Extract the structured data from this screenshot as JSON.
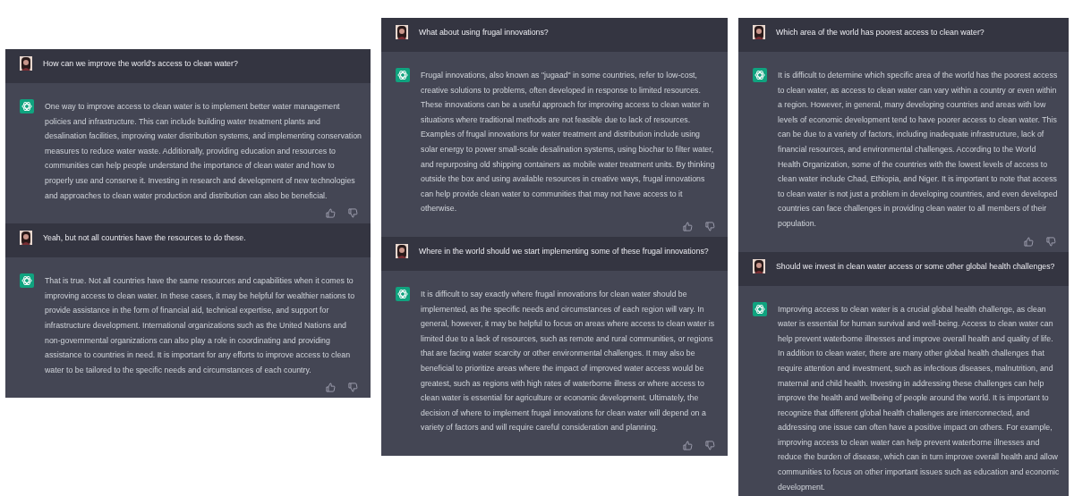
{
  "panels": [
    {
      "messages": [
        {
          "kind": "user",
          "text": "How can we improve the world's access to clean water?"
        },
        {
          "kind": "assistant",
          "feedback": true,
          "text": "One way to improve access to clean water is to implement better water management policies and infrastructure. This can include building water treatment plants and desalination facilities, improving water distribution systems, and implementing conservation measures to reduce water waste. Additionally, providing education and resources to communities can help people understand the importance of clean water and how to properly use and conserve it. Investing in research and development of new technologies and approaches to clean water production and distribution can also be beneficial."
        },
        {
          "kind": "user",
          "text": "Yeah, but not all countries have the resources to do these."
        },
        {
          "kind": "assistant",
          "feedback": true,
          "text": "That is true. Not all countries have the same resources and capabilities when it comes to improving access to clean water. In these cases, it may be helpful for wealthier nations to provide assistance in the form of financial aid, technical expertise, and support for infrastructure development. International organizations such as the United Nations and non-governmental organizations can also play a role in coordinating and providing assistance to countries in need. It is important for any efforts to improve access to clean water to be tailored to the specific needs and circumstances of each country."
        }
      ]
    },
    {
      "messages": [
        {
          "kind": "user",
          "text": "What about using frugal innovations?"
        },
        {
          "kind": "assistant",
          "feedback": true,
          "text": "Frugal innovations, also known as \"jugaad\" in some countries, refer to low-cost, creative solutions to problems, often developed in response to limited resources. These innovations can be a useful approach for improving access to clean water in situations where traditional methods are not feasible due to lack of resources. Examples of frugal innovations for water treatment and distribution include using solar energy to power small-scale desalination systems, using biochar to filter water, and repurposing old shipping containers as mobile water treatment units. By thinking outside the box and using available resources in creative ways, frugal innovations can help provide clean water to communities that may not have access to it otherwise."
        },
        {
          "kind": "user",
          "text": "Where in the world should we start implementing some of these frugal innovations?"
        },
        {
          "kind": "assistant",
          "feedback": true,
          "text": "It is difficult to say exactly where frugal innovations for clean water should be implemented, as the specific needs and circumstances of each region will vary. In general, however, it may be helpful to focus on areas where access to clean water is limited due to a lack of resources, such as remote and rural communities, or regions that are facing water scarcity or other environmental challenges. It may also be beneficial to prioritize areas where the impact of improved water access would be greatest, such as regions with high rates of waterborne illness or where access to clean water is essential for agriculture or economic development. Ultimately, the decision of where to implement frugal innovations for clean water will depend on a variety of factors and will require careful consideration and planning."
        }
      ]
    },
    {
      "messages": [
        {
          "kind": "user",
          "text": "Which area of the world has poorest access to clean water?"
        },
        {
          "kind": "assistant",
          "feedback": true,
          "text": "It is difficult to determine which specific area of the world has the poorest access to clean water, as access to clean water can vary within a country or even within a region. However, in general, many developing countries and areas with low levels of economic development tend to have poorer access to clean water. This can be due to a variety of factors, including inadequate infrastructure, lack of financial resources, and environmental challenges. According to the World Health Organization, some of the countries with the lowest levels of access to clean water include Chad, Ethiopia, and Niger. It is important to note that access to clean water is not just a problem in developing countries, and even developed countries can face challenges in providing clean water to all members of their population."
        },
        {
          "kind": "user",
          "text": "Should we invest in clean water access or some other global health challenges?"
        },
        {
          "kind": "assistant",
          "feedback": false,
          "text": "Improving access to clean water is a crucial global health challenge, as clean water is essential for human survival and well-being. Access to clean water can help prevent waterborne illnesses and improve overall health and quality of life. In addition to clean water, there are many other global health challenges that require attention and investment, such as infectious diseases, malnutrition, and maternal and child health. Investing in addressing these challenges can help improve the health and wellbeing of people around the world. It is important to recognize that different global health challenges are interconnected, and addressing one issue can often have a positive impact on others. For example, improving access to clean water can help prevent waterborne illnesses and reduce the burden of disease, which can in turn improve overall health and allow communities to focus on other important issues such as education and economic development."
        }
      ]
    }
  ]
}
